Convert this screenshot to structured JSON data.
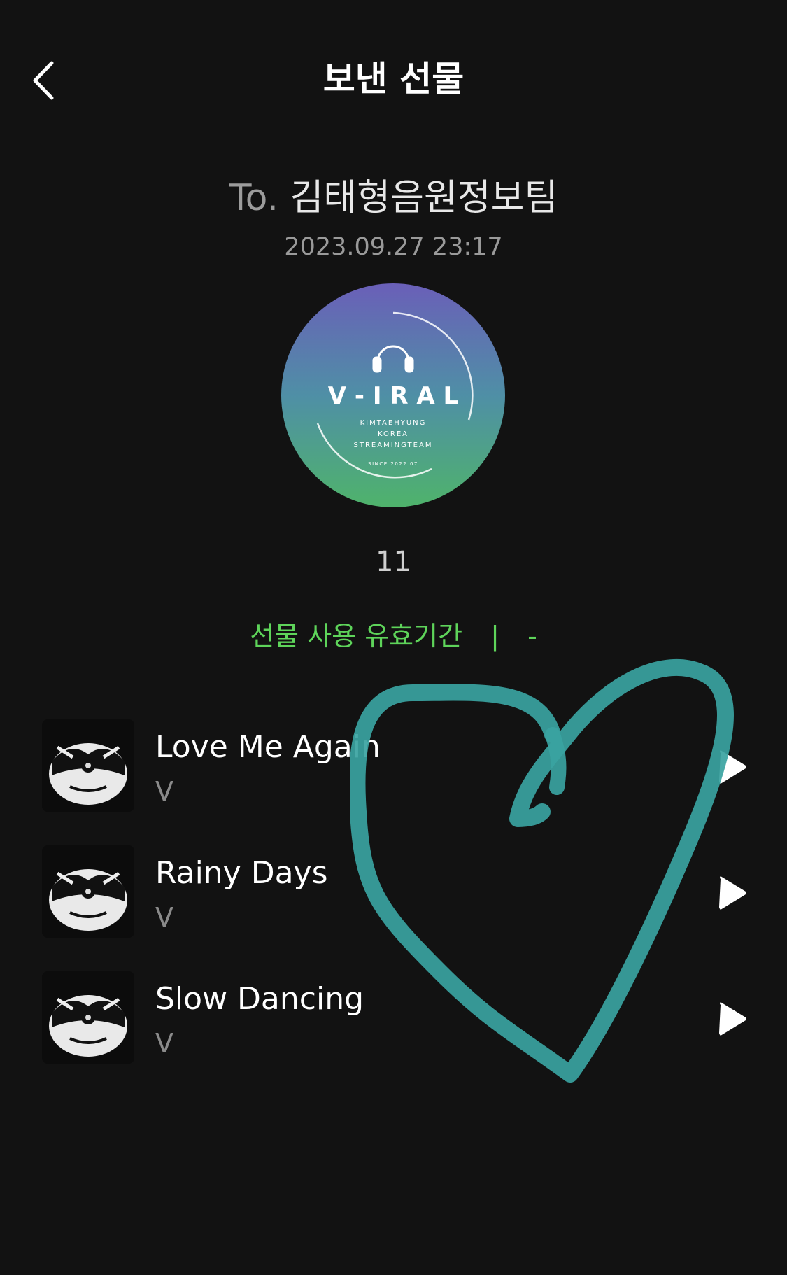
{
  "header": {
    "title": "보낸 선물",
    "back_icon": "chevron-left-icon"
  },
  "gift": {
    "recipient_prefix": "To.",
    "recipient_name": "김태형음원정보팀",
    "sent_at": "2023.09.27 23:17",
    "count": "11",
    "validity_label": "선물 사용 유효기간",
    "validity_separator": "|",
    "validity_value": "-"
  },
  "avatar": {
    "logo_text": "V - I R A L",
    "line1": "KIMTAEHYUNG",
    "line2": "KOREA",
    "line3": "STREAMINGTEAM",
    "since": "SINCE 2022.07",
    "gradient_top": "#6a5fb8",
    "gradient_bottom": "#4fb36b"
  },
  "tracks": [
    {
      "title": "Love Me Again",
      "artist": "V"
    },
    {
      "title": "Rainy Days",
      "artist": "V"
    },
    {
      "title": "Slow Dancing",
      "artist": "V"
    }
  ],
  "colors": {
    "background": "#121212",
    "accent_green": "#5ed45a",
    "heart_scribble": "#3aa3a1"
  }
}
